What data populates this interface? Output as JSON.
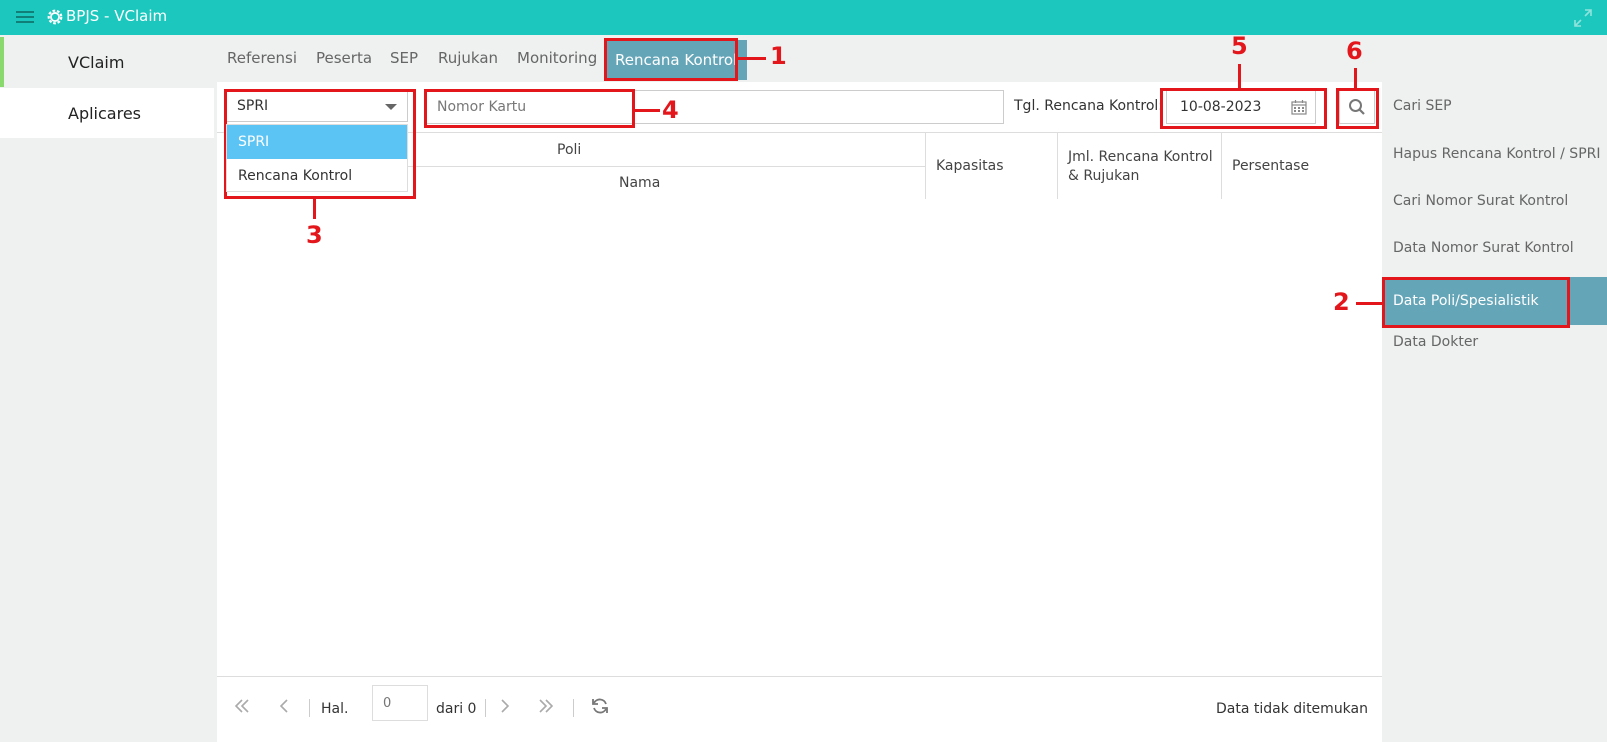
{
  "app": {
    "title": "BPJS - VClaim"
  },
  "left_nav": {
    "items": [
      {
        "label": "VClaim"
      },
      {
        "label": "Aplicares"
      }
    ]
  },
  "tabs": [
    {
      "label": "Referensi"
    },
    {
      "label": "Peserta"
    },
    {
      "label": "SEP"
    },
    {
      "label": "Rujukan"
    },
    {
      "label": "Monitoring"
    },
    {
      "label": "Rencana Kontrol"
    }
  ],
  "filter": {
    "select_value": "SPRI",
    "options": [
      {
        "label": "SPRI"
      },
      {
        "label": "Rencana Kontrol"
      }
    ],
    "nomor_placeholder": "Nomor Kartu",
    "tgl_label": "Tgl. Rencana Kontrol:",
    "tgl_value": "10-08-2023"
  },
  "table": {
    "header_poli": "Poli",
    "header_nama": "Nama",
    "header_kapasitas": "Kapasitas",
    "header_jml_line1": "Jml. Rencana Kontrol",
    "header_jml_line2": "& Rujukan",
    "header_persentase": "Persentase"
  },
  "pager": {
    "hal_label": "Hal.",
    "page_placeholder": "0",
    "dari_label": "dari 0",
    "status": "Data tidak ditemukan"
  },
  "right_nav": {
    "items": [
      {
        "label": "Cari SEP"
      },
      {
        "label": "Hapus Rencana Kontrol / SPRI"
      },
      {
        "label": "Cari Nomor Surat Kontrol"
      },
      {
        "label": "Data Nomor Surat Kontrol"
      },
      {
        "label": "Data Poli/Spesialistik"
      },
      {
        "label": "Data Dokter"
      }
    ]
  },
  "annotations": [
    {
      "label": "1"
    },
    {
      "label": "2"
    },
    {
      "label": "3"
    },
    {
      "label": "4"
    },
    {
      "label": "5"
    },
    {
      "label": "6"
    }
  ],
  "colors": {
    "topbar": "#1cc7bd",
    "active": "#64a5b8",
    "dropdown_selected": "#5bc4f5",
    "annotation": "#e3161c"
  }
}
